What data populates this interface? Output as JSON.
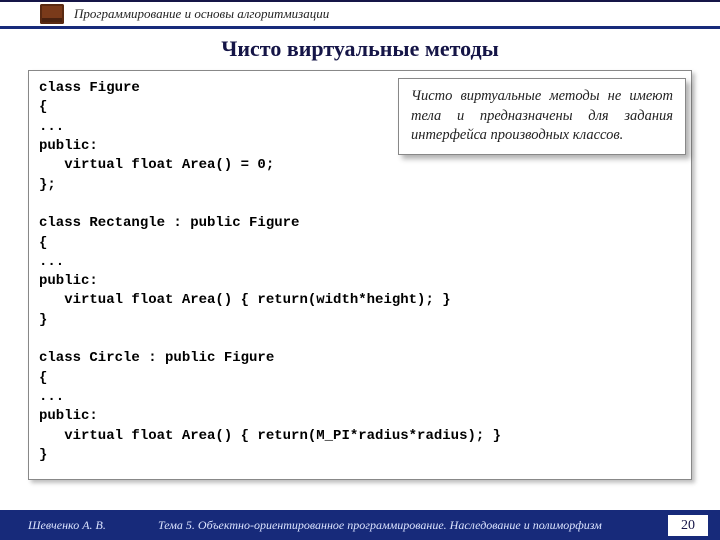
{
  "header": {
    "course": "Программирование и основы алгоритмизации"
  },
  "title": "Чисто виртуальные методы",
  "code": "class Figure\n{\n...\npublic:\n   virtual float Area() = 0;\n};\n\nclass Rectangle : public Figure\n{\n...\npublic:\n   virtual float Area() { return(width*height); }\n}\n\nclass Circle : public Figure\n{\n...\npublic:\n   virtual float Area() { return(M_PI*radius*radius); }\n}",
  "note": "Чисто виртуальные методы не имеют тела и предназначены для задания интерфейса производных классов.",
  "footer": {
    "author": "Шевченко А. В.",
    "topic": "Тема 5. Объектно-ориентированное программирование. Наследование и полиморфизм",
    "page": "20"
  }
}
